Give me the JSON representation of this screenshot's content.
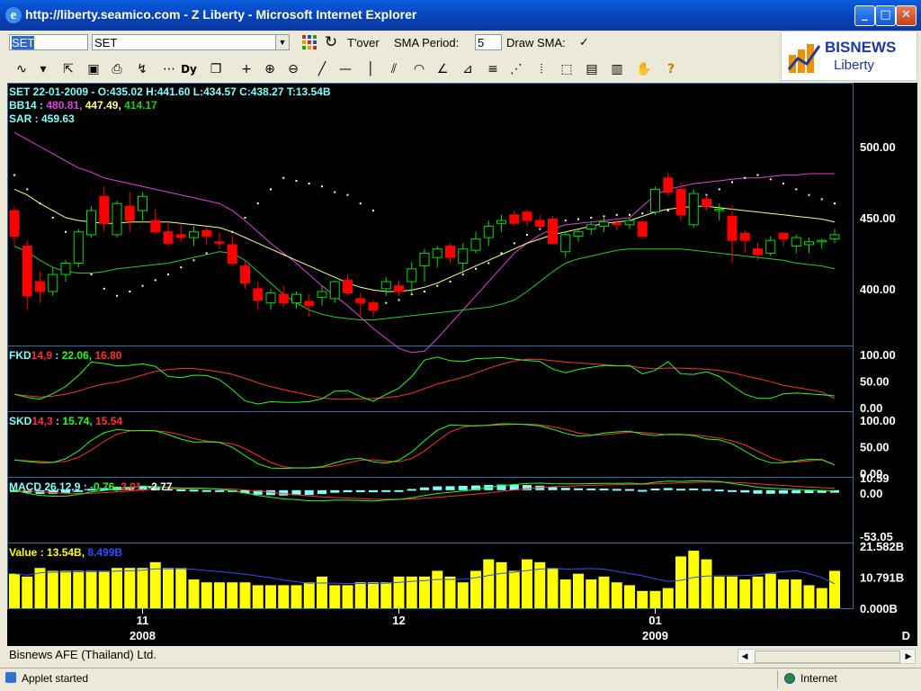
{
  "window": {
    "title": "http://liberty.seamico.com - Z Liberty - Microsoft Internet Explorer"
  },
  "toolbar": {
    "symbol_input": "SET",
    "symbol_select": "SET",
    "tover_label": "T'over",
    "sma_period_label": "SMA Period:",
    "sma_period_value": "5",
    "draw_sma_label": "Draw SMA:",
    "draw_sma_checked": "✓"
  },
  "logo": {
    "main": "BISNEWS",
    "sub": "Liberty"
  },
  "icons": [
    "line-chart-icon",
    "dropdown-arrow-icon",
    "export-icon",
    "save-icon",
    "print-icon",
    "indicator-icon",
    "dotted-line-icon",
    "dy-icon",
    "copy-icon",
    "crosshair-icon",
    "zoom-in-icon",
    "zoom-out-icon",
    "trendline-icon",
    "horizontal-line-icon",
    "vertical-line-icon",
    "channel-icon",
    "arc-icon",
    "fan-icon",
    "speed-line-icon",
    "fibonacci-icon",
    "gann-icon",
    "cycle-icon",
    "select-icon",
    "clipboard-icon",
    "delete-all-icon",
    "hand-icon",
    "help-icon"
  ],
  "panels": {
    "price": {
      "header1": "SET 22-01-2009 - O:435.02 H:441.60 L:434.57 C:438.27 T:13.54B",
      "bb_label": "BB14 :",
      "bb_upper": "480.81,",
      "bb_mid": "447.49,",
      "bb_lower": "414.17",
      "sar_label": "SAR : 459.63",
      "y_ticks": [
        "500.00",
        "450.00",
        "400.00"
      ]
    },
    "fkd": {
      "label": "FKD",
      "params": "14,9",
      "sep": " :",
      "k": "22.06,",
      "d": "16.80",
      "y_ticks": [
        "100.00",
        "50.00",
        "0.00"
      ]
    },
    "skd": {
      "label": "SKD",
      "params": "14,3",
      "sep": " :",
      "k": "15.74,",
      "d": "15.54",
      "y_ticks": [
        "100.00",
        "50.00",
        "0.00"
      ]
    },
    "macd": {
      "label": "MACD 26,12,9 :",
      "v1": "-0.76,",
      "v2": "2.01,",
      "v3": "-2.77",
      "y_ticks": [
        "10.59",
        "0.00",
        "-53.05"
      ]
    },
    "value": {
      "label": "Value :",
      "v1": "13.54B,",
      "v2": "8.499B",
      "y_ticks": [
        "21.582B",
        "10.791B",
        "0.000B"
      ]
    }
  },
  "x_axis": {
    "months": [
      "11",
      "12",
      "01"
    ],
    "years": [
      "2008",
      "2009"
    ],
    "corner": "D"
  },
  "status": {
    "company": "Bisnews AFE (Thailand) Ltd.",
    "applet": "Applet started",
    "zone": "Internet"
  },
  "colors": {
    "up": "#00e000",
    "down": "#ff0000",
    "bb_upper": "#e040e0",
    "bb_mid": "#ffff80",
    "bb_lower": "#20d020",
    "volume": "#ffff00",
    "vol_ma": "#3050ff",
    "macd_hist": "#80ffff",
    "label_cyan": "#80ffff"
  },
  "chart_data": {
    "type": "candlestick",
    "ohlc_price_panel": {
      "ylim": [
        360,
        545
      ],
      "candles": [
        [
          455,
          458,
          430,
          437
        ],
        [
          430,
          434,
          385,
          395
        ],
        [
          405,
          412,
          390,
          398
        ],
        [
          398,
          415,
          395,
          410
        ],
        [
          410,
          420,
          405,
          418
        ],
        [
          418,
          442,
          415,
          440
        ],
        [
          438,
          458,
          436,
          455
        ],
        [
          465,
          472,
          440,
          446
        ],
        [
          438,
          462,
          436,
          460
        ],
        [
          458,
          468,
          440,
          448
        ],
        [
          455,
          468,
          448,
          465
        ],
        [
          448,
          456,
          438,
          440
        ],
        [
          440,
          446,
          430,
          432
        ],
        [
          438,
          445,
          433,
          436
        ],
        [
          436,
          444,
          430,
          440
        ],
        [
          441,
          443,
          431,
          437
        ],
        [
          433,
          440,
          428,
          432
        ],
        [
          431,
          437,
          416,
          418
        ],
        [
          416,
          420,
          400,
          404
        ],
        [
          400,
          405,
          385,
          392
        ],
        [
          390,
          400,
          385,
          397
        ],
        [
          396,
          402,
          387,
          390
        ],
        [
          390,
          398,
          386,
          396
        ],
        [
          391,
          396,
          380,
          388
        ],
        [
          394,
          402,
          388,
          398
        ],
        [
          393,
          406,
          390,
          405
        ],
        [
          406,
          410,
          395,
          397
        ],
        [
          393,
          397,
          381,
          390
        ],
        [
          390,
          392,
          380,
          385
        ],
        [
          400,
          408,
          395,
          405
        ],
        [
          402,
          406,
          395,
          398
        ],
        [
          405,
          419,
          396,
          414
        ],
        [
          416,
          428,
          405,
          425
        ],
        [
          422,
          430,
          415,
          428
        ],
        [
          430,
          432,
          418,
          422
        ],
        [
          418,
          432,
          410,
          428
        ],
        [
          427,
          440,
          425,
          435
        ],
        [
          436,
          448,
          430,
          444
        ],
        [
          446,
          452,
          440,
          448
        ],
        [
          452,
          455,
          444,
          446
        ],
        [
          454,
          456,
          444,
          448
        ],
        [
          448,
          452,
          442,
          444
        ],
        [
          449,
          451,
          431,
          432
        ],
        [
          426,
          440,
          422,
          438
        ],
        [
          437,
          442,
          433,
          440
        ],
        [
          442,
          447,
          438,
          445
        ],
        [
          444,
          450,
          440,
          447
        ],
        [
          446,
          449,
          441,
          445
        ],
        [
          445,
          450,
          442,
          448
        ],
        [
          447,
          448,
          435,
          437
        ],
        [
          454,
          472,
          452,
          470
        ],
        [
          478,
          482,
          465,
          468
        ],
        [
          470,
          475,
          448,
          452
        ],
        [
          445,
          470,
          443,
          467
        ],
        [
          463,
          466,
          455,
          458
        ],
        [
          455,
          460,
          448,
          456
        ],
        [
          451,
          459,
          418,
          434
        ],
        [
          439,
          441,
          425,
          434
        ],
        [
          428,
          432,
          420,
          424
        ],
        [
          425,
          437,
          423,
          434
        ],
        [
          439,
          440,
          430,
          435
        ],
        [
          430,
          438,
          425,
          436
        ],
        [
          431,
          436,
          425,
          433
        ],
        [
          433,
          435,
          428,
          434
        ],
        [
          435,
          442,
          432,
          438
        ]
      ],
      "bb_upper": [
        510,
        505,
        500,
        495,
        490,
        485,
        482,
        478,
        476,
        474,
        472,
        470,
        468,
        466,
        464,
        462,
        460,
        455,
        448,
        440,
        432,
        425,
        418,
        410,
        402,
        395,
        388,
        380,
        372,
        365,
        358,
        355,
        356,
        365,
        375,
        385,
        395,
        405,
        415,
        425,
        432,
        438,
        442,
        445,
        446,
        447,
        448,
        449,
        450,
        458,
        466,
        470,
        472,
        474,
        475,
        476,
        477,
        478,
        478,
        479,
        480,
        480,
        481,
        481,
        481
      ],
      "bb_mid": [
        470,
        466,
        460,
        455,
        450,
        448,
        447,
        446,
        446,
        447,
        447,
        447,
        447,
        446,
        445,
        444,
        443,
        440,
        436,
        432,
        428,
        424,
        420,
        416,
        412,
        408,
        404,
        401,
        399,
        398,
        398,
        399,
        401,
        404,
        408,
        412,
        416,
        420,
        424,
        428,
        432,
        435,
        438,
        440,
        442,
        444,
        446,
        447,
        448,
        451,
        454,
        456,
        457,
        458,
        458,
        457,
        456,
        455,
        454,
        453,
        452,
        451,
        450,
        449,
        447
      ],
      "bb_lower": [
        430,
        426,
        420,
        415,
        412,
        411,
        411,
        412,
        414,
        415,
        416,
        417,
        418,
        420,
        422,
        424,
        426,
        425,
        420,
        412,
        404,
        396,
        390,
        385,
        382,
        380,
        379,
        378,
        378,
        379,
        380,
        381,
        382,
        383,
        384,
        385,
        386,
        387,
        389,
        392,
        398,
        405,
        412,
        418,
        421,
        423,
        425,
        427,
        428,
        428,
        428,
        428,
        428,
        427,
        426,
        425,
        424,
        423,
        422,
        421,
        420,
        418,
        417,
        416,
        414
      ],
      "sar": [
        480,
        470,
        460,
        450,
        440,
        420,
        410,
        400,
        395,
        398,
        402,
        406,
        410,
        415,
        420,
        425,
        432,
        440,
        450,
        460,
        470,
        478,
        476,
        474,
        472,
        468,
        466,
        460,
        455,
        390,
        392,
        396,
        398,
        402,
        405,
        410,
        414,
        418,
        425,
        432,
        438,
        442,
        446,
        448,
        449,
        450,
        451,
        452,
        452,
        453,
        454,
        455,
        456,
        460,
        466,
        470,
        475,
        478,
        480,
        477,
        474,
        470,
        466,
        463,
        460
      ]
    },
    "fkd": {
      "ylim": [
        0,
        110
      ],
      "k_last": 22.06,
      "d_last": 16.8
    },
    "skd": {
      "ylim": [
        0,
        110
      ],
      "k_last": 15.74,
      "d_last": 15.54
    },
    "macd": {
      "ylim": [
        -53.05,
        10.59
      ],
      "macd": -0.76,
      "signal": 2.01,
      "hist": -2.77
    },
    "value": {
      "ylim": [
        0,
        21.582
      ],
      "bars": [
        12,
        11,
        14,
        13,
        13,
        13,
        13,
        13,
        14,
        14,
        14,
        16,
        14,
        14,
        10,
        9,
        9,
        9,
        9,
        8,
        8,
        8,
        8,
        9,
        11,
        8,
        8,
        9,
        9,
        9,
        11,
        11,
        11,
        13,
        11,
        9,
        13,
        17,
        16,
        13,
        17,
        16,
        14,
        10,
        12,
        10,
        11,
        9,
        8,
        6,
        6,
        7,
        18,
        20,
        17,
        11,
        11,
        10,
        11,
        12,
        10,
        10,
        8,
        7,
        13
      ],
      "ma_last": 8.499,
      "last": 13.54
    },
    "x_tick_labels": [
      "11",
      "12",
      "01"
    ],
    "year_labels": [
      "2008",
      "2009"
    ]
  }
}
